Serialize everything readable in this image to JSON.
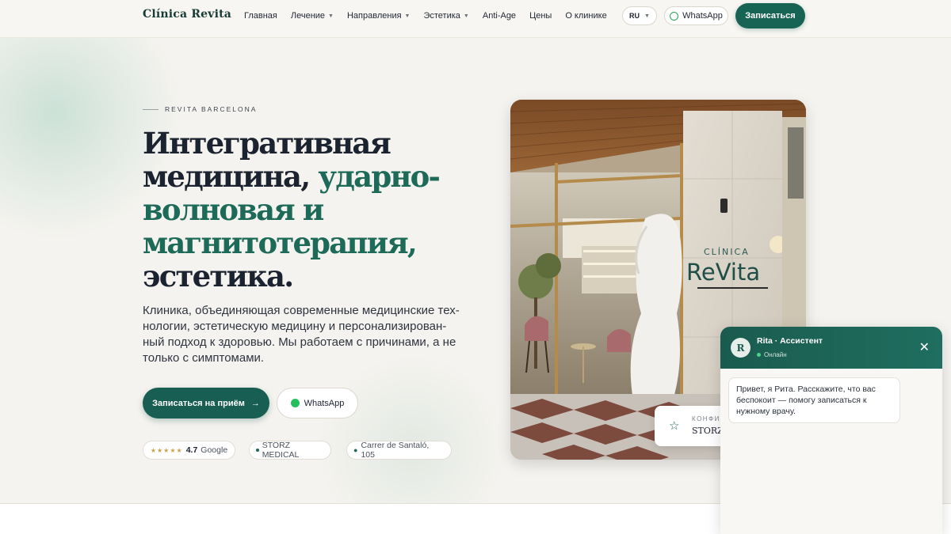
{
  "header": {
    "logo": "Clínica Revita",
    "nav": [
      {
        "label": "Главная",
        "dropdown": false
      },
      {
        "label": "Лечение",
        "dropdown": true
      },
      {
        "label": "Направления",
        "dropdown": true
      },
      {
        "label": "Эстетика",
        "dropdown": true
      },
      {
        "label": "Anti-Age",
        "dropdown": false
      },
      {
        "label": "Цены",
        "dropdown": false
      },
      {
        "label": "О клинике",
        "dropdown": false
      }
    ],
    "lang": "RU",
    "whatsapp": "WhatsApp",
    "book": "Записаться"
  },
  "hero": {
    "eyebrow": "REVITA BARCELONA",
    "headline_part1": "Интегративная медицина,",
    "headline_accent": "ударно-волновая и магнитотерапия,",
    "headline_part2": "эстетика.",
    "lead": "Клиника, объединяющая современные медицинские тех­нологии, эстетическую медицину и персонализирован­ный подход к здоровью. Мы работаем с причинами, а не только с симптомами.",
    "cta_primary": "Записаться на приём",
    "cta_secondary": "WhatsApp",
    "badges": {
      "rating": "4.7",
      "rating_source": "Google",
      "partner": "STORZ MEDICAL",
      "address": "Carrer de Santaló, 105"
    }
  },
  "photo": {
    "sign_small": "CLÍNICA",
    "sign_large": "ReVita"
  },
  "storz_card": {
    "label": "КОНФИД",
    "value": "STORZ"
  },
  "chat": {
    "avatar": "R",
    "name": "Rita · Ассистент",
    "status": "Онлайн",
    "message": "Привет, я Рита. Расскажите, что вас бес­покоит — помогу записаться к нужному врачу."
  },
  "colors": {
    "brand": "#176455",
    "accent_text": "#1d6a58",
    "background": "#f5f3ef",
    "whatsapp": "#25c05e"
  },
  "icons": {
    "cta_arrow": "arrow-right-icon",
    "badge_pin": "map-pin-icon",
    "storz_star": "star-outline-icon",
    "chat_close": "close-icon"
  }
}
